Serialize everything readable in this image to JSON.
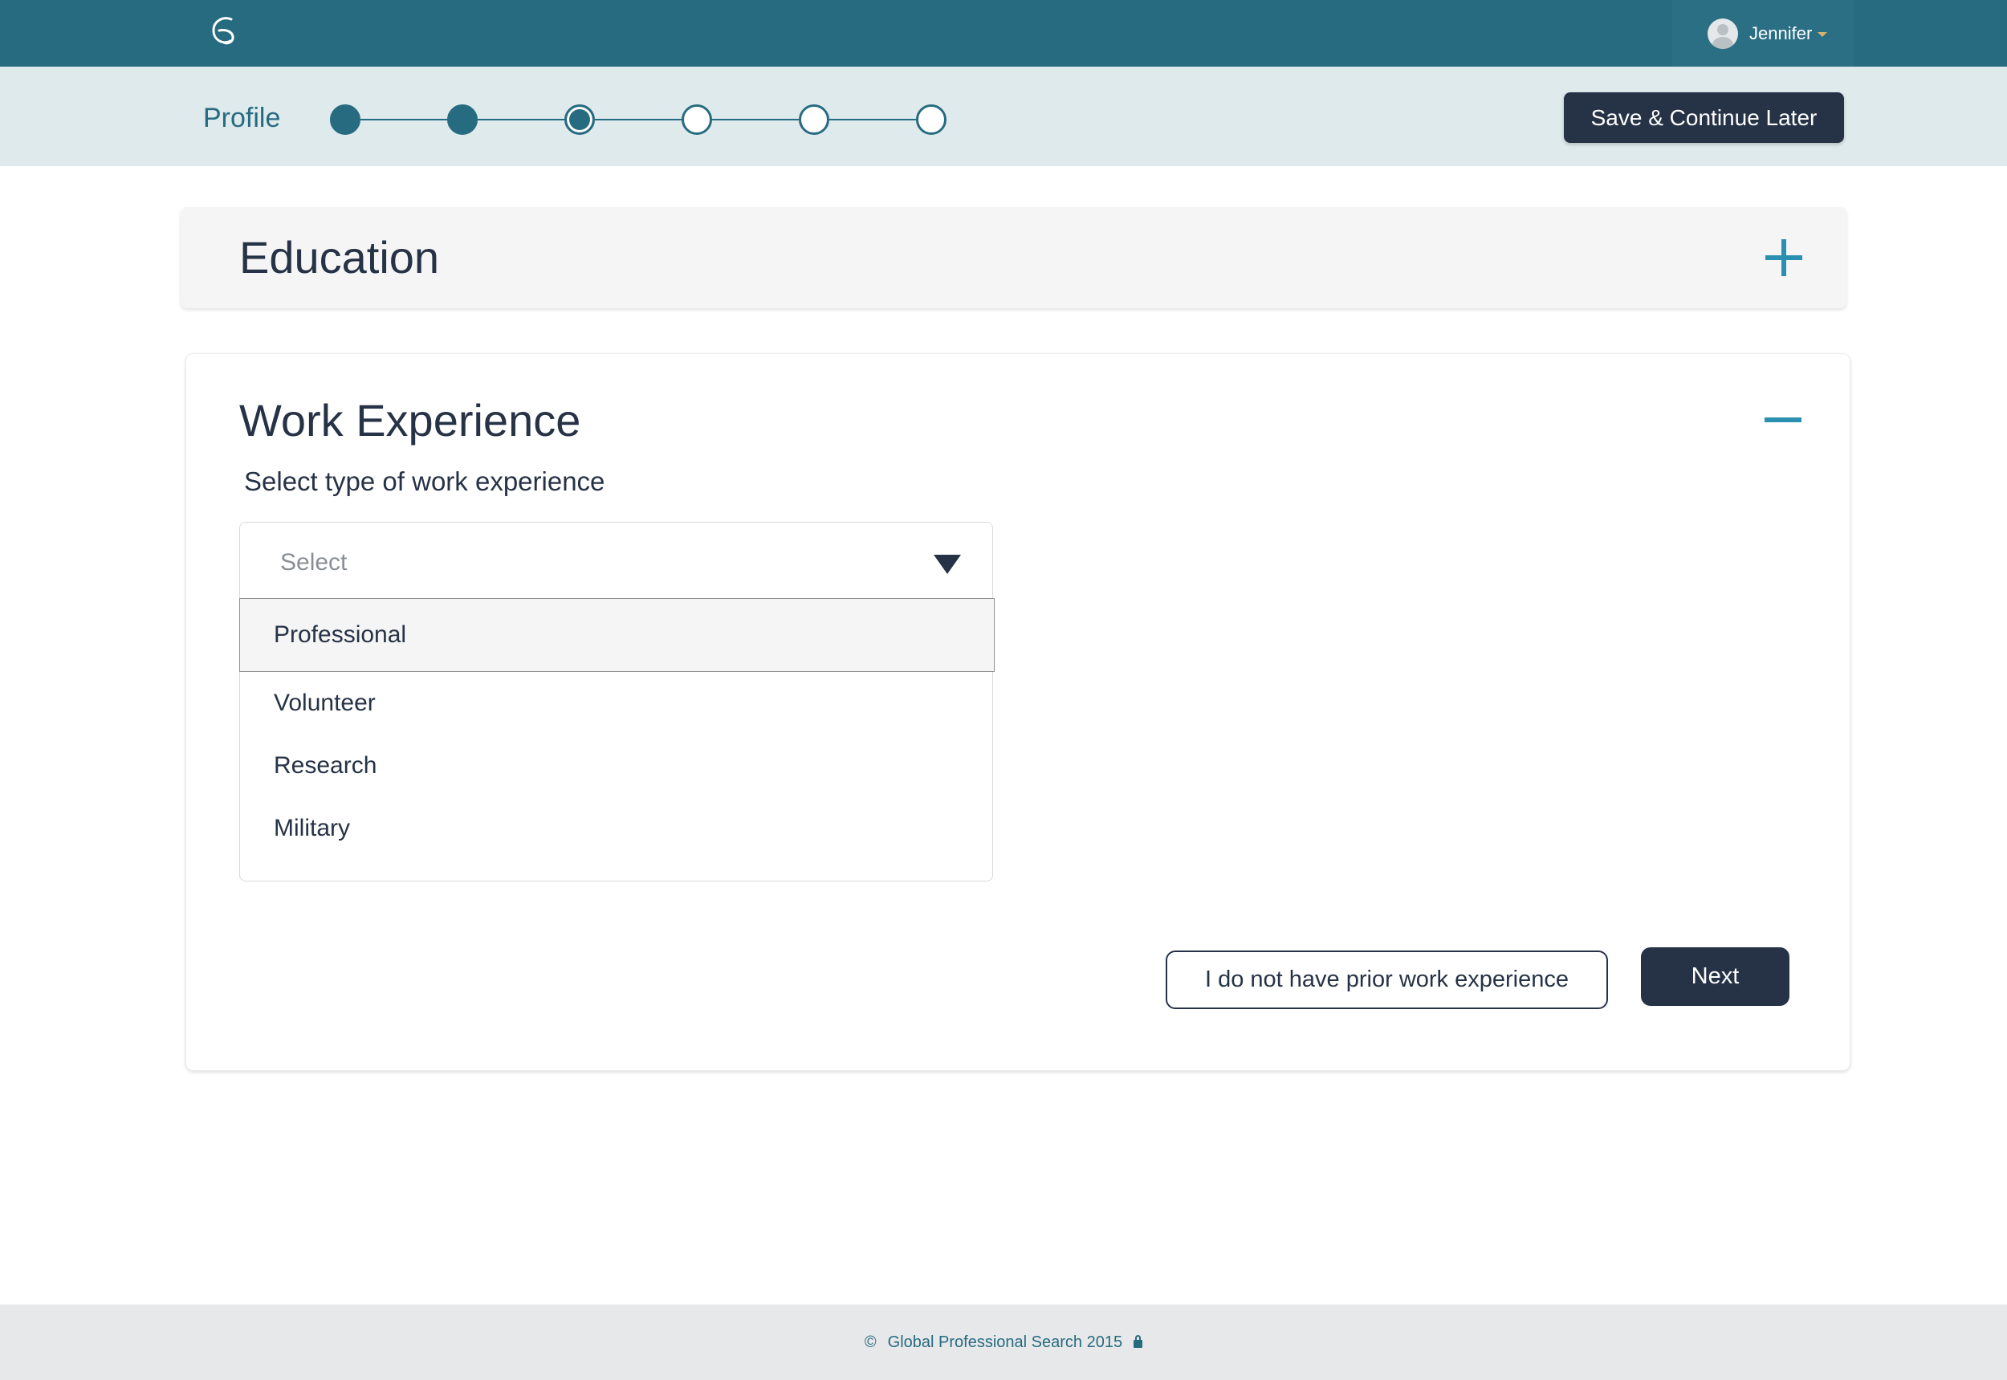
{
  "header": {
    "user_name": "Jennifer"
  },
  "progress": {
    "title": "Profile",
    "total_steps": 6,
    "completed_steps": 2,
    "current_step": 3,
    "save_label": "Save & Continue Later"
  },
  "education": {
    "title": "Education",
    "toggle_icon": "plus-icon"
  },
  "work_experience": {
    "title": "Work Experience",
    "toggle_icon": "minus-icon",
    "subtitle": "Select type of work experience",
    "select_placeholder": "Select",
    "options": [
      "Professional",
      "Volunteer",
      "Research",
      "Military"
    ],
    "highlighted_option": "Professional",
    "no_experience_label": "I do not have prior work experience",
    "next_label": "Next"
  },
  "footer": {
    "copyright_symbol": "©",
    "text": "Global Professional Search 2015"
  },
  "colors": {
    "header": "#276b80",
    "progress_bg": "#dfeaec",
    "dark_button": "#263246",
    "accent": "#2a8fb1"
  }
}
